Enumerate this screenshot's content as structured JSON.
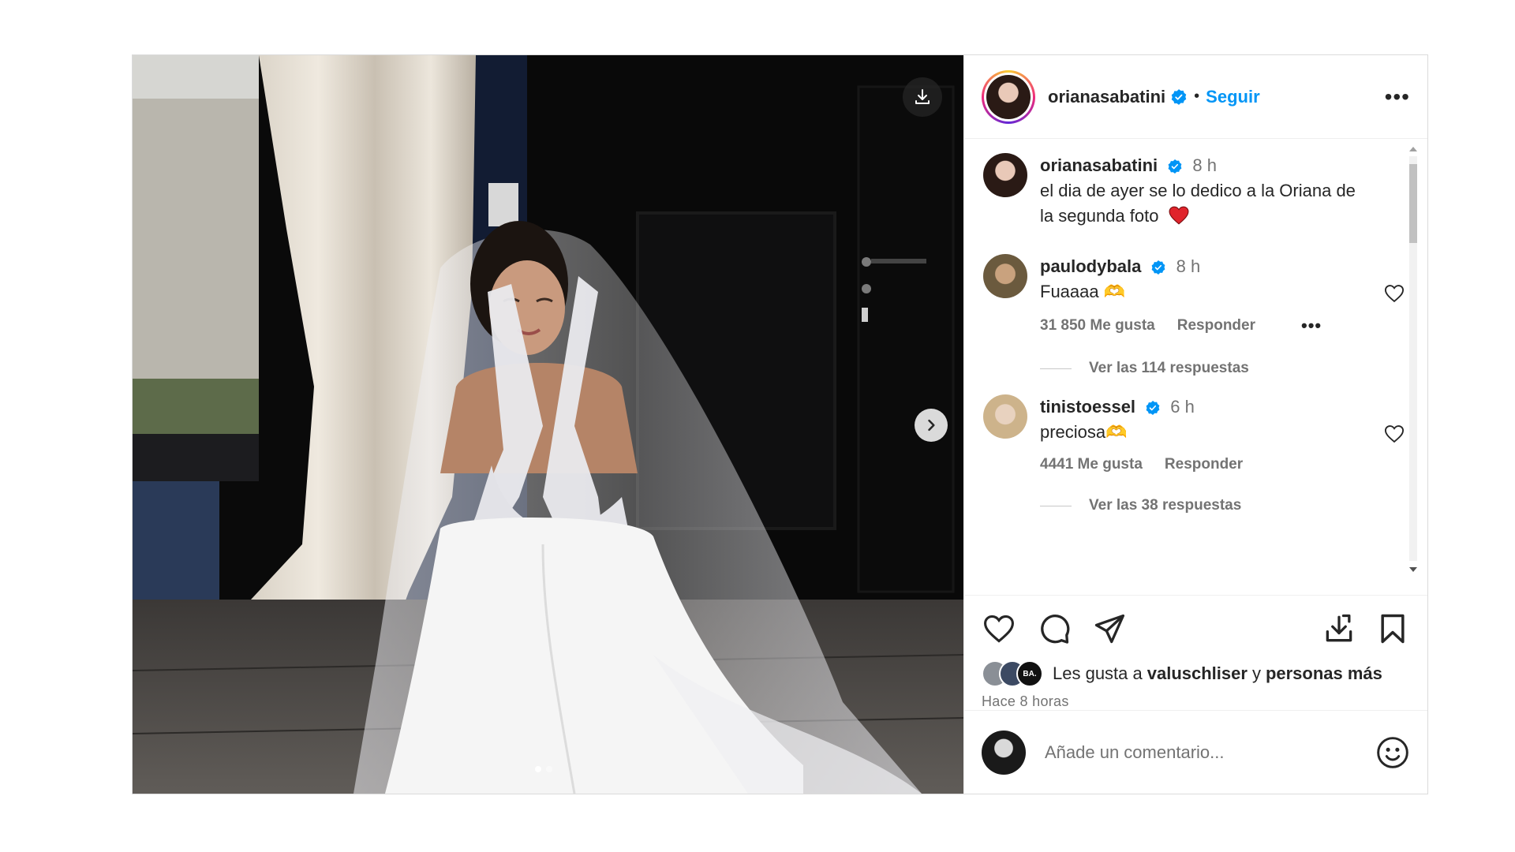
{
  "post": {
    "author": "orianasabatini",
    "follow_label": "Seguir",
    "separator": "•",
    "more_label": "•••"
  },
  "media": {
    "slides": 2,
    "active_slide": 1
  },
  "caption": {
    "user": "orianasabatini",
    "time": "8 h",
    "text": "el dia de ayer se lo dedico a la Oriana de la segunda foto"
  },
  "comments": [
    {
      "user": "paulodybala",
      "time": "8 h",
      "text": "Fuaaaa 🫶",
      "likes": "31 850 Me gusta",
      "reply": "Responder",
      "replies": "Ver las 114 respuestas"
    },
    {
      "user": "tinistoessel",
      "time": "6 h",
      "text": "preciosa🫶",
      "likes": "4441 Me gusta",
      "reply": "Responder",
      "replies": "Ver las 38 respuestas"
    }
  ],
  "likes": {
    "prefix": "Les gusta a",
    "user": "valuschliser",
    "conj": "y",
    "suffix": "personas más",
    "stack_label": "BA."
  },
  "timestamp": "Hace 8 horas",
  "composer": {
    "placeholder": "Añade un comentario..."
  },
  "icons": [
    "download-icon",
    "chevron-right-icon",
    "heart-icon",
    "comment-icon",
    "share-icon",
    "save-download-icon",
    "bookmark-icon",
    "verified-badge-icon",
    "emoji-icon",
    "more-icon"
  ],
  "colors": {
    "accent": "#0095f6",
    "verified": "#0095f6",
    "text": "#262626",
    "secondary": "#737373",
    "heart_red": "#ed4956"
  }
}
